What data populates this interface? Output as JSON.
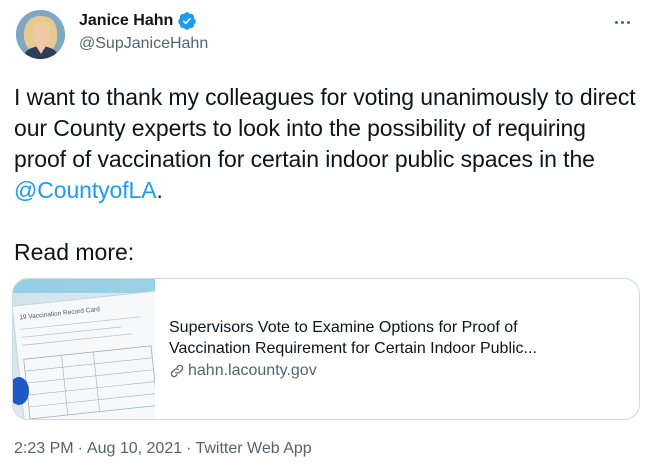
{
  "author": {
    "display_name": "Janice Hahn",
    "handle": "@SupJaniceHahn",
    "verified": true
  },
  "icons": {
    "verified": "verified-badge-icon",
    "more": "more-icon",
    "link": "link-icon"
  },
  "tweet": {
    "text_before": "I want to thank my colleagues for voting unanimously to direct our County experts to look into the possibility of requiring proof of vaccination for certain indoor public spaces in the ",
    "mention": "@CountyofLA",
    "text_after": ".",
    "read_more": "Read more:"
  },
  "card": {
    "title": "Supervisors Vote to Examine Options for Proof of Vaccination Requirement for Certain Indoor Public...",
    "domain": "hahn.lacounty.gov",
    "thumbnail_text": "19 Vaccination Record Card"
  },
  "meta": {
    "time": "2:23 PM",
    "separator_1": "·",
    "date": "Aug 10, 2021",
    "separator_2": "·",
    "source": "Twitter Web App"
  },
  "colors": {
    "accent": "#1d9bf0",
    "text": "#0f1419",
    "secondary": "#536471",
    "border": "#cfd9de"
  }
}
